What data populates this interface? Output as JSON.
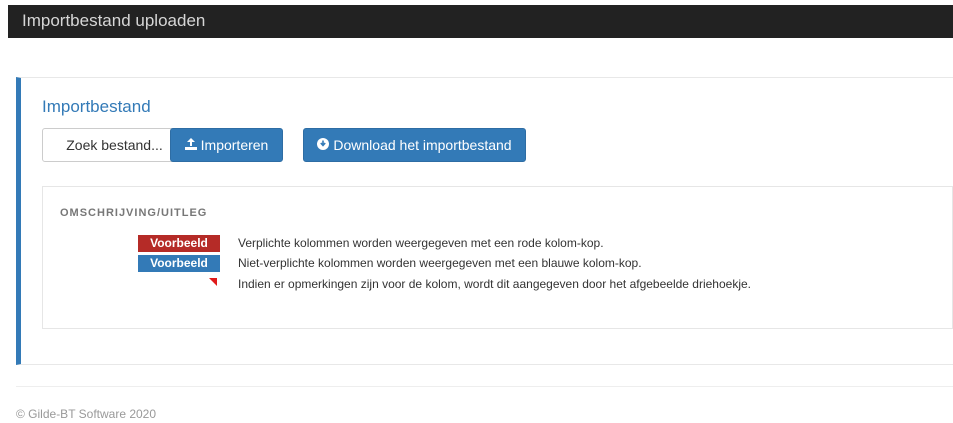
{
  "header": {
    "title": "Importbestand uploaden"
  },
  "panel": {
    "title": "Importbestand",
    "file_button": "Zoek bestand...",
    "import_button": "Importeren",
    "download_button": "Download het importbestand"
  },
  "legend": {
    "heading": "OMSCHRIJVING/UITLEG",
    "items": [
      {
        "tag": "Voorbeeld",
        "text": "Verplichte kolommen worden weergegeven met een rode kolom-kop."
      },
      {
        "tag": "Voorbeeld",
        "text": "Niet-verplichte kolommen worden weergegeven met een blauwe kolom-kop."
      },
      {
        "text": "Indien er opmerkingen zijn voor de kolom, wordt dit aangegeven door het afgebeelde driehoekje."
      }
    ]
  },
  "footer": {
    "text": "© Gilde-BT Software 2020"
  },
  "colors": {
    "primary": "#337ab7",
    "required": "#b52b27",
    "titlebar": "#222222"
  },
  "icons": {
    "import": "upload-icon",
    "download": "download-circle-icon"
  }
}
